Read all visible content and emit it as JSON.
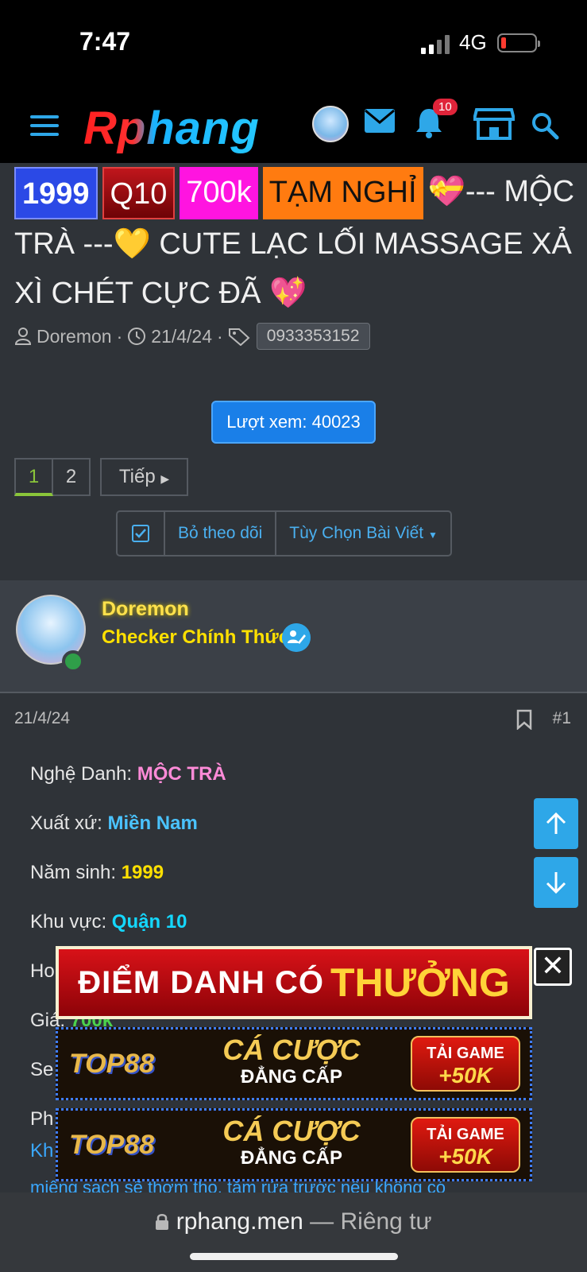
{
  "status": {
    "time": "7:47",
    "network": "4G"
  },
  "header": {
    "logo": "Rphang",
    "notif_count": "10"
  },
  "thread": {
    "tags": [
      "1999",
      "Q10",
      "700k",
      "TẠM NGHỈ"
    ],
    "title": "💝--- MỘC TRÀ ---💛 CUTE LẠC LỐI MASSAGE XẢ XÌ CHÉT CỰC ĐÃ 💖",
    "author": "Doremon",
    "date": "21/4/24",
    "phone_tag": "0933353152",
    "views": "Lượt xem: 40023"
  },
  "pager": {
    "pages": [
      "1",
      "2"
    ],
    "next": "Tiếp"
  },
  "actions": {
    "unwatch": "Bỏ theo dõi",
    "options": "Tùy Chọn Bài Viết"
  },
  "post": {
    "author": "Doremon",
    "role": "Checker Chính Thức",
    "date": "21/4/24",
    "number": "#1",
    "fields": [
      {
        "label": "Nghệ Danh: ",
        "value": "MỘC TRÀ"
      },
      {
        "label": "Xuất xứ: ",
        "value": "Miền Nam"
      },
      {
        "label": "Năm sinh: ",
        "value": "1999"
      },
      {
        "label": "Khu vực: ",
        "value": "Quận 10"
      },
      {
        "label": "Ho",
        "value": ""
      },
      {
        "label": "Giá: ",
        "value": "700k"
      },
      {
        "label": "Se",
        "value": ""
      },
      {
        "label": "Ph",
        "value": ""
      }
    ],
    "peek_link": "Kh",
    "clipped_text": "miệng sạch sẽ thơm tho, tắm rửa trước nếu không có"
  },
  "ads": {
    "top_a": "ĐIỂM DANH CÓ",
    "top_b": "THƯỞNG",
    "banner_logo": "TOP88",
    "banner_line1": "CÁ CƯỢC",
    "banner_line2": "ĐẲNG CẤP",
    "cta1": "TẢI GAME",
    "cta2": "+50K"
  },
  "urlbar": {
    "domain": "rphang.men",
    "sep": " — ",
    "private": "Riêng tư"
  },
  "colors": {
    "accent": "#2ea7e8",
    "gold": "#ffe000",
    "pink": "#ff8bd8",
    "cyan": "#14d8ff"
  }
}
